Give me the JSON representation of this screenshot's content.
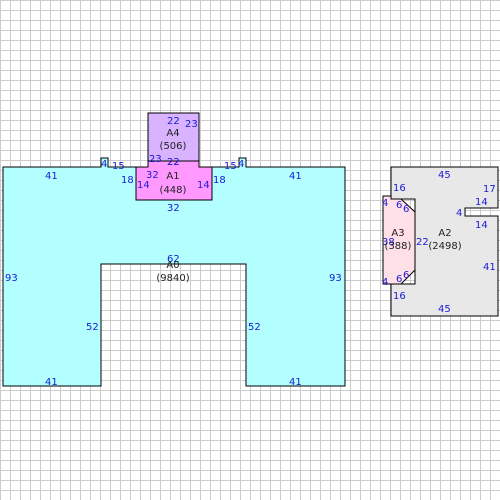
{
  "areas": [
    {
      "id": "A0",
      "area": "(9840)",
      "fill": "#b3ffff",
      "dims": [
        "41",
        "15",
        "4",
        "4",
        "15",
        "41",
        "93",
        "41",
        "52",
        "62",
        "52",
        "41",
        "93",
        "18",
        "32",
        "18"
      ]
    },
    {
      "id": "A1",
      "area": "(448)",
      "fill": "#ff99ff",
      "dims": [
        "32",
        "22",
        "14",
        "14",
        "18",
        "18"
      ]
    },
    {
      "id": "A4",
      "area": "(506)",
      "fill": "#d9b3ff",
      "dims": [
        "22",
        "23",
        "23",
        "22"
      ]
    },
    {
      "id": "A2",
      "area": "(2498)",
      "fill": "#e8e8e8",
      "dims": [
        "45",
        "17",
        "14",
        "4",
        "14",
        "41",
        "45",
        "16",
        "16",
        "22"
      ]
    },
    {
      "id": "A3",
      "area": "(388)",
      "fill": "#ffe0e6",
      "dims": [
        "4",
        "6",
        "6",
        "38",
        "4",
        "6",
        "6"
      ]
    }
  ],
  "colors": {
    "grid": "#cccccc",
    "outline": "#000000",
    "dimension_text": "#1a1ad6",
    "label_text": "#222222"
  }
}
